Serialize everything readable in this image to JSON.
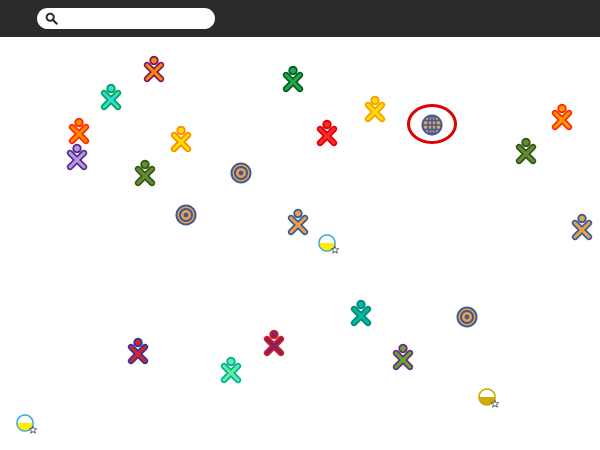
{
  "toolbar": {
    "search": {
      "value": "",
      "placeholder": "",
      "icon": "search-icon"
    }
  },
  "neighborhood": {
    "buddies": [
      {
        "stroke": "#7a1a6a",
        "fill": "#ff8a00"
      },
      {
        "stroke": "#00a651",
        "fill": "#33d9e0"
      },
      {
        "stroke": "#005c2a",
        "fill": "#22aa44"
      },
      {
        "stroke": "#ff9a00",
        "fill": "#ffe000"
      },
      {
        "stroke": "#ff2a00",
        "fill": "#ff8a00"
      },
      {
        "stroke": "#ff8a00",
        "fill": "#ffe000"
      },
      {
        "stroke": "#dd0000",
        "fill": "#ff2a2a"
      },
      {
        "stroke": "#ff2a00",
        "fill": "#ff9a00"
      },
      {
        "stroke": "#5a2a8a",
        "fill": "#b49ae8"
      },
      {
        "stroke": "#2e5a10",
        "fill": "#6a8a3a"
      },
      {
        "stroke": "#2e5a10",
        "fill": "#6a8a3a"
      },
      {
        "stroke": "#3a5aa0",
        "fill": "#f0a040"
      },
      {
        "stroke": "#3a5aa0",
        "fill": "#f0a040"
      },
      {
        "stroke": "#008a7a",
        "fill": "#00b8a0"
      },
      {
        "stroke": "#333399",
        "fill": "#dd2222"
      },
      {
        "stroke": "#cc2222",
        "fill": "#8a1a6a"
      },
      {
        "stroke": "#00b0a0",
        "fill": "#66ee99"
      },
      {
        "stroke": "#6a2a8a",
        "fill": "#66aa22"
      }
    ],
    "activities": [
      {
        "icon": "target-icon",
        "stroke": "#3a5aa0",
        "fill": "#f0a040"
      },
      {
        "icon": "target-icon",
        "stroke": "#3a5aa0",
        "fill": "#f0a040"
      },
      {
        "icon": "target-icon",
        "stroke": "#3a5aa0",
        "fill": "#f0a040"
      },
      {
        "icon": "globe-icon",
        "stroke": "#3a5aa0",
        "fill": "#f0a040",
        "highlighted": true,
        "ring_color": "#e00000"
      }
    ],
    "access_points": [
      {
        "icon": "wireless-network-icon",
        "fill": "#ffee00",
        "stroke": "#3aa8d8"
      },
      {
        "icon": "wireless-network-icon",
        "fill": "#ffee00",
        "stroke": "#3aa8d8"
      },
      {
        "icon": "wireless-network-icon",
        "fill": "#ccaa00",
        "stroke": "#ccaa00"
      }
    ]
  }
}
